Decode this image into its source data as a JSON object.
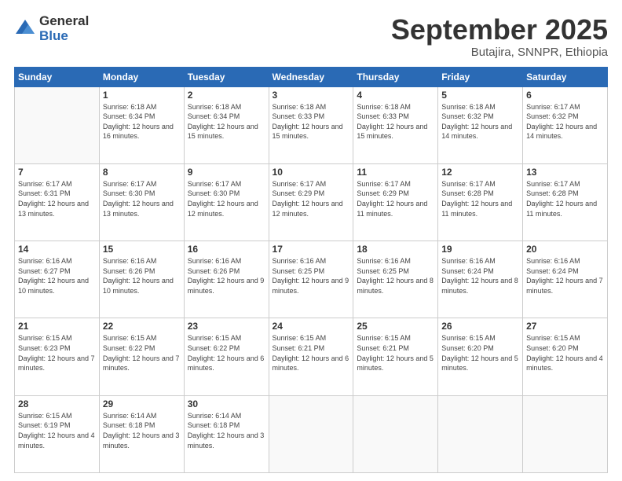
{
  "logo": {
    "general": "General",
    "blue": "Blue"
  },
  "header": {
    "month": "September 2025",
    "location": "Butajira, SNNPR, Ethiopia"
  },
  "weekdays": [
    "Sunday",
    "Monday",
    "Tuesday",
    "Wednesday",
    "Thursday",
    "Friday",
    "Saturday"
  ],
  "weeks": [
    [
      {
        "day": "",
        "empty": true
      },
      {
        "day": "1",
        "sunrise": "6:18 AM",
        "sunset": "6:34 PM",
        "daylight": "12 hours and 16 minutes."
      },
      {
        "day": "2",
        "sunrise": "6:18 AM",
        "sunset": "6:34 PM",
        "daylight": "12 hours and 15 minutes."
      },
      {
        "day": "3",
        "sunrise": "6:18 AM",
        "sunset": "6:33 PM",
        "daylight": "12 hours and 15 minutes."
      },
      {
        "day": "4",
        "sunrise": "6:18 AM",
        "sunset": "6:33 PM",
        "daylight": "12 hours and 15 minutes."
      },
      {
        "day": "5",
        "sunrise": "6:18 AM",
        "sunset": "6:32 PM",
        "daylight": "12 hours and 14 minutes."
      },
      {
        "day": "6",
        "sunrise": "6:17 AM",
        "sunset": "6:32 PM",
        "daylight": "12 hours and 14 minutes."
      }
    ],
    [
      {
        "day": "7",
        "sunrise": "6:17 AM",
        "sunset": "6:31 PM",
        "daylight": "12 hours and 13 minutes."
      },
      {
        "day": "8",
        "sunrise": "6:17 AM",
        "sunset": "6:30 PM",
        "daylight": "12 hours and 13 minutes."
      },
      {
        "day": "9",
        "sunrise": "6:17 AM",
        "sunset": "6:30 PM",
        "daylight": "12 hours and 12 minutes."
      },
      {
        "day": "10",
        "sunrise": "6:17 AM",
        "sunset": "6:29 PM",
        "daylight": "12 hours and 12 minutes."
      },
      {
        "day": "11",
        "sunrise": "6:17 AM",
        "sunset": "6:29 PM",
        "daylight": "12 hours and 11 minutes."
      },
      {
        "day": "12",
        "sunrise": "6:17 AM",
        "sunset": "6:28 PM",
        "daylight": "12 hours and 11 minutes."
      },
      {
        "day": "13",
        "sunrise": "6:17 AM",
        "sunset": "6:28 PM",
        "daylight": "12 hours and 11 minutes."
      }
    ],
    [
      {
        "day": "14",
        "sunrise": "6:16 AM",
        "sunset": "6:27 PM",
        "daylight": "12 hours and 10 minutes."
      },
      {
        "day": "15",
        "sunrise": "6:16 AM",
        "sunset": "6:26 PM",
        "daylight": "12 hours and 10 minutes."
      },
      {
        "day": "16",
        "sunrise": "6:16 AM",
        "sunset": "6:26 PM",
        "daylight": "12 hours and 9 minutes."
      },
      {
        "day": "17",
        "sunrise": "6:16 AM",
        "sunset": "6:25 PM",
        "daylight": "12 hours and 9 minutes."
      },
      {
        "day": "18",
        "sunrise": "6:16 AM",
        "sunset": "6:25 PM",
        "daylight": "12 hours and 8 minutes."
      },
      {
        "day": "19",
        "sunrise": "6:16 AM",
        "sunset": "6:24 PM",
        "daylight": "12 hours and 8 minutes."
      },
      {
        "day": "20",
        "sunrise": "6:16 AM",
        "sunset": "6:24 PM",
        "daylight": "12 hours and 7 minutes."
      }
    ],
    [
      {
        "day": "21",
        "sunrise": "6:15 AM",
        "sunset": "6:23 PM",
        "daylight": "12 hours and 7 minutes."
      },
      {
        "day": "22",
        "sunrise": "6:15 AM",
        "sunset": "6:22 PM",
        "daylight": "12 hours and 7 minutes."
      },
      {
        "day": "23",
        "sunrise": "6:15 AM",
        "sunset": "6:22 PM",
        "daylight": "12 hours and 6 minutes."
      },
      {
        "day": "24",
        "sunrise": "6:15 AM",
        "sunset": "6:21 PM",
        "daylight": "12 hours and 6 minutes."
      },
      {
        "day": "25",
        "sunrise": "6:15 AM",
        "sunset": "6:21 PM",
        "daylight": "12 hours and 5 minutes."
      },
      {
        "day": "26",
        "sunrise": "6:15 AM",
        "sunset": "6:20 PM",
        "daylight": "12 hours and 5 minutes."
      },
      {
        "day": "27",
        "sunrise": "6:15 AM",
        "sunset": "6:20 PM",
        "daylight": "12 hours and 4 minutes."
      }
    ],
    [
      {
        "day": "28",
        "sunrise": "6:15 AM",
        "sunset": "6:19 PM",
        "daylight": "12 hours and 4 minutes."
      },
      {
        "day": "29",
        "sunrise": "6:14 AM",
        "sunset": "6:18 PM",
        "daylight": "12 hours and 3 minutes."
      },
      {
        "day": "30",
        "sunrise": "6:14 AM",
        "sunset": "6:18 PM",
        "daylight": "12 hours and 3 minutes."
      },
      {
        "day": "",
        "empty": true
      },
      {
        "day": "",
        "empty": true
      },
      {
        "day": "",
        "empty": true
      },
      {
        "day": "",
        "empty": true
      }
    ]
  ]
}
